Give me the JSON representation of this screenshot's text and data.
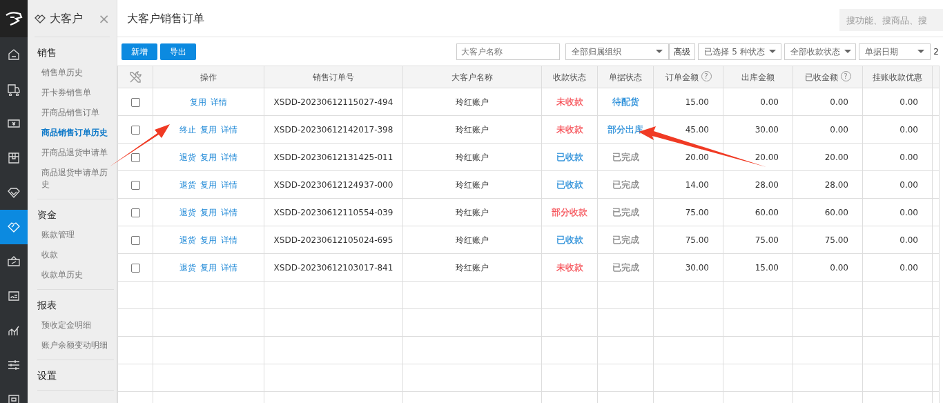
{
  "rail": [
    {
      "selected": false
    },
    {
      "selected": false
    },
    {
      "selected": false
    },
    {
      "selected": false
    },
    {
      "selected": false
    },
    {
      "selected": true
    },
    {
      "selected": false
    },
    {
      "selected": false
    },
    {
      "selected": false
    },
    {
      "selected": false
    },
    {
      "selected": false
    }
  ],
  "sidebar": {
    "title": "大客户",
    "close": "×",
    "sections": [
      {
        "heading": "销售",
        "items": [
          {
            "label": "销售单历史",
            "selected": false
          },
          {
            "label": "开卡券销售单",
            "selected": false
          },
          {
            "label": "开商品销售订单",
            "selected": false
          },
          {
            "label": "商品销售订单历史",
            "selected": true
          },
          {
            "label": "开商品退货申请单",
            "selected": false
          },
          {
            "label": "商品退货申请单历史",
            "selected": false
          }
        ]
      },
      {
        "heading": "资金",
        "items": [
          {
            "label": "账款管理",
            "selected": false
          },
          {
            "label": "收款",
            "selected": false
          },
          {
            "label": "收款单历史",
            "selected": false
          }
        ]
      },
      {
        "heading": "报表",
        "items": [
          {
            "label": "预收定金明细",
            "selected": false
          },
          {
            "label": "账户余额变动明细",
            "selected": false
          }
        ]
      },
      {
        "heading": "设置"
      }
    ]
  },
  "header": {
    "title": "大客户销售订单",
    "search": {
      "placeholder": "搜功能、搜商品、搜"
    }
  },
  "toolbar": {
    "buttons": [
      "新增",
      "导出"
    ],
    "name_field": {
      "placeholder": "大客户名称"
    },
    "org_select": "全部归属组织",
    "advanced": "高级",
    "status_select": "已选择 5 种状态",
    "payment_select": "全部收款状态",
    "date_select": "单据日期",
    "cut_text": "2"
  },
  "table": {
    "columns": [
      "操作",
      "销售订单号",
      "大客户名称",
      "收款状态",
      "单据状态",
      {
        "label": "订单金额",
        "help": "?"
      },
      "出库金额",
      {
        "label": "已收金额",
        "help": "?"
      },
      "挂账收款优惠"
    ],
    "rows": [
      {
        "checked": false,
        "actions": [
          "复用",
          "详情"
        ],
        "order_no": "XSDD-20230612115027-494",
        "customer": "玲红账户",
        "payment": {
          "text": "未收款",
          "color": "#f5484f"
        },
        "status": {
          "text": "待配货",
          "color": "#1a86d6"
        },
        "order_amount": "15.00",
        "out_amount": "0.00",
        "received": "0.00",
        "discount": "0.00"
      },
      {
        "checked": false,
        "actions": [
          "终止",
          "复用",
          "详情"
        ],
        "order_no": "XSDD-20230612142017-398",
        "customer": "玲红账户",
        "payment": {
          "text": "未收款",
          "color": "#f5484f"
        },
        "status": {
          "text": "部分出库",
          "color": "#1a86d6"
        },
        "order_amount": "45.00",
        "out_amount": "30.00",
        "received": "0.00",
        "discount": "0.00"
      },
      {
        "checked": false,
        "actions": [
          "退货",
          "复用",
          "详情"
        ],
        "order_no": "XSDD-20230612131425-011",
        "customer": "玲红账户",
        "payment": {
          "text": "已收款",
          "color": "#1a86d6"
        },
        "status": {
          "text": "已完成",
          "color": "#808080"
        },
        "order_amount": "20.00",
        "out_amount": "20.00",
        "received": "20.00",
        "discount": "0.00"
      },
      {
        "checked": false,
        "actions": [
          "退货",
          "复用",
          "详情"
        ],
        "order_no": "XSDD-20230612124937-000",
        "customer": "玲红账户",
        "payment": {
          "text": "已收款",
          "color": "#1a86d6"
        },
        "status": {
          "text": "已完成",
          "color": "#808080"
        },
        "order_amount": "14.00",
        "out_amount": "28.00",
        "received": "28.00",
        "discount": "0.00"
      },
      {
        "checked": false,
        "actions": [
          "退货",
          "复用",
          "详情"
        ],
        "order_no": "XSDD-20230612110554-039",
        "customer": "玲红账户",
        "payment": {
          "text": "部分收款",
          "color": "#f5484f"
        },
        "status": {
          "text": "已完成",
          "color": "#808080"
        },
        "order_amount": "75.00",
        "out_amount": "60.00",
        "received": "60.00",
        "discount": "0.00"
      },
      {
        "checked": false,
        "actions": [
          "退货",
          "复用",
          "详情"
        ],
        "order_no": "XSDD-20230612105024-695",
        "customer": "玲红账户",
        "payment": {
          "text": "已收款",
          "color": "#1a86d6"
        },
        "status": {
          "text": "已完成",
          "color": "#808080"
        },
        "order_amount": "75.00",
        "out_amount": "75.00",
        "received": "75.00",
        "discount": "0.00"
      },
      {
        "checked": false,
        "actions": [
          "退货",
          "复用",
          "详情"
        ],
        "order_no": "XSDD-20230612103017-841",
        "customer": "玲红账户",
        "payment": {
          "text": "未收款",
          "color": "#f5484f"
        },
        "status": {
          "text": "已完成",
          "color": "#808080"
        },
        "order_amount": "30.00",
        "out_amount": "15.00",
        "received": "0.00",
        "discount": "0.00"
      }
    ]
  }
}
